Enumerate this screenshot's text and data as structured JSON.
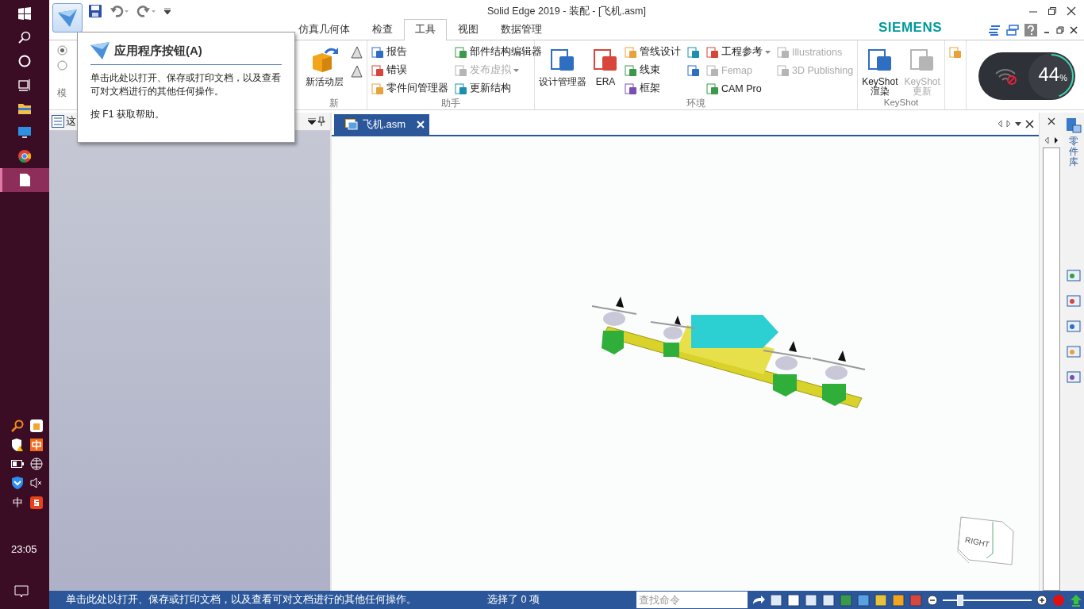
{
  "taskbar": {
    "items": [
      {
        "kind": "start",
        "selected": false
      },
      {
        "kind": "search",
        "selected": false
      },
      {
        "kind": "cortana",
        "selected": false
      },
      {
        "kind": "taskview",
        "selected": false
      },
      {
        "kind": "explorer",
        "selected": false
      },
      {
        "kind": "monitor",
        "selected": false
      },
      {
        "kind": "chrome",
        "selected": false
      },
      {
        "kind": "file",
        "selected": true
      }
    ],
    "input_mode": "中",
    "time": "23:05"
  },
  "window": {
    "title": "Solid Edge 2019 - 装配 - [飞机.asm]"
  },
  "brand": "SIEMENS",
  "tabs": [
    {
      "label": "仿真几何体",
      "selected": false
    },
    {
      "label": "检查",
      "selected": false
    },
    {
      "label": "工具",
      "selected": true
    },
    {
      "label": "视图",
      "selected": false
    },
    {
      "label": "数据管理",
      "selected": false
    }
  ],
  "ribbon": {
    "left_radios": [
      {
        "selected": true
      },
      {
        "selected": false
      }
    ],
    "left_group_label": "模",
    "layer_button": "新活动层",
    "layer_group_label": "新",
    "groups": [
      {
        "label": "助手",
        "columns": [
          [
            {
              "kind": "small",
              "label": "报告",
              "disabled": false
            },
            {
              "kind": "small",
              "label": "错误",
              "disabled": false
            },
            {
              "kind": "small",
              "label": "零件间管理器",
              "disabled": false
            }
          ],
          [
            {
              "kind": "small",
              "label": "部件结构编辑器",
              "disabled": false
            },
            {
              "kind": "small",
              "label": "发布虚拟",
              "disabled": true,
              "dropdown": true
            },
            {
              "kind": "small",
              "label": "更新结构",
              "disabled": false
            }
          ]
        ]
      },
      {
        "label": "环境",
        "columns": [
          [
            {
              "kind": "large",
              "label": "设计管理器",
              "disabled": false
            }
          ],
          [
            {
              "kind": "large",
              "label": "ERA",
              "disabled": false
            }
          ],
          [
            {
              "kind": "small",
              "label": "管线设计",
              "disabled": false
            },
            {
              "kind": "small",
              "label": "线束",
              "disabled": false
            },
            {
              "kind": "small",
              "label": "框架",
              "disabled": false
            }
          ],
          [
            {
              "kind": "icon",
              "disabled": false
            },
            {
              "kind": "icon",
              "disabled": false
            }
          ],
          [
            {
              "kind": "small",
              "label": "工程参考",
              "disabled": false,
              "dropdown": true
            },
            {
              "kind": "small",
              "label": "Femap",
              "disabled": true
            },
            {
              "kind": "small",
              "label": "CAM Pro",
              "disabled": false
            }
          ],
          [
            {
              "kind": "small",
              "label": "Illustrations",
              "disabled": true
            },
            {
              "kind": "small",
              "label": "3D Publishing",
              "disabled": true
            }
          ]
        ]
      },
      {
        "label": "KeyShot",
        "columns": [
          [
            {
              "kind": "large",
              "label": "KeyShot\n渲染",
              "disabled": false
            }
          ],
          [
            {
              "kind": "large",
              "label": "KeyShot\n更新",
              "disabled": true
            }
          ]
        ]
      },
      {
        "columns": [
          [
            {
              "kind": "icon",
              "disabled": false
            }
          ]
        ]
      }
    ]
  },
  "net_widget": {
    "percent": "44",
    "unit": "%",
    "level": 0.44
  },
  "tooltip": {
    "title": "应用程序按钮(A)",
    "body": "单击此处以打开、保存或打印文档，以及查看可对文档进行的其他任何操作。",
    "help": "按 F1 获取帮助。"
  },
  "pane": {
    "title": "这"
  },
  "document": {
    "tabs": [
      {
        "label": "飞机.asm",
        "selected": true
      }
    ],
    "view_cube_label": "RIGHT"
  },
  "side_panel": {
    "label": "零件库"
  },
  "status_bar": {
    "message": "单击此处以打开、保存或打印文档，以及查看可对文档进行的其他任何操作。",
    "selection": "选择了 0 项",
    "search": {
      "placeholder": "查找命令"
    },
    "zoom_slider": {
      "level": 0.2
    }
  }
}
